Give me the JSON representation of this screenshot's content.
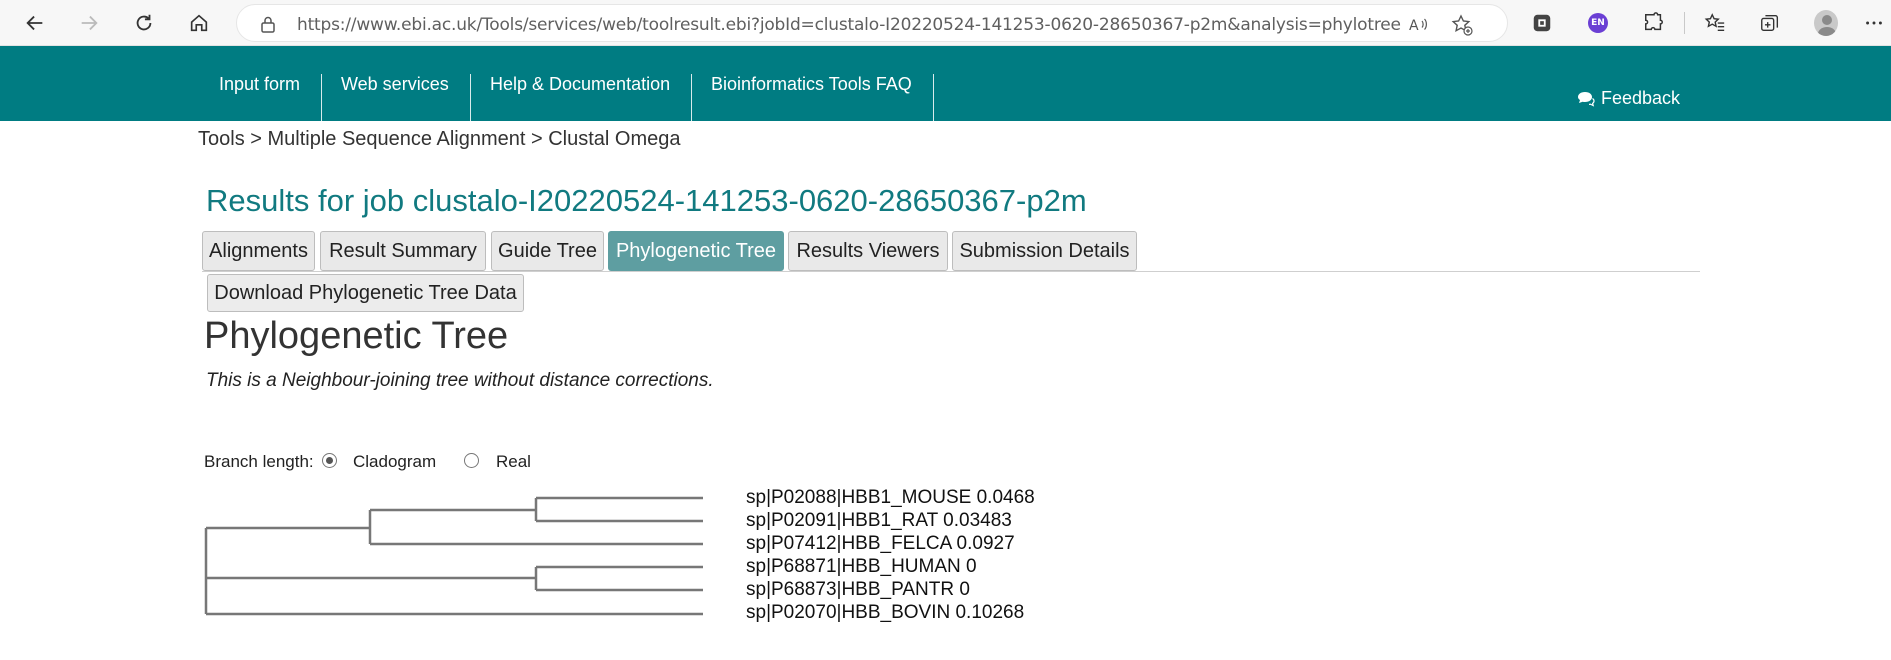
{
  "browser": {
    "url": "https://www.ebi.ac.uk/Tools/services/web/toolresult.ebi?jobId=clustalo-I20220524-141253-0620-28650367-p2m&analysis=phylotree",
    "extension_badge": "EN"
  },
  "site_nav": {
    "items": [
      "Input form",
      "Web services",
      "Help & Documentation",
      "Bioinformatics Tools FAQ"
    ],
    "feedback_label": "Feedback"
  },
  "breadcrumb": "Tools > Multiple Sequence Alignment > Clustal Omega",
  "job_title": "Results for job clustalo-I20220524-141253-0620-28650367-p2m",
  "tabs": [
    {
      "label": "Alignments",
      "active": false
    },
    {
      "label": "Result Summary",
      "active": false
    },
    {
      "label": "Guide Tree",
      "active": false
    },
    {
      "label": "Phylogenetic Tree",
      "active": true
    },
    {
      "label": "Results Viewers",
      "active": false
    },
    {
      "label": "Submission Details",
      "active": false
    }
  ],
  "download_label": "Download Phylogenetic Tree Data",
  "section_title": "Phylogenetic Tree",
  "tree_note": "This is a Neighbour-joining tree without distance corrections.",
  "branch_length": {
    "label": "Branch length:",
    "options": [
      {
        "label": "Cladogram",
        "selected": true
      },
      {
        "label": "Real",
        "selected": false
      }
    ]
  },
  "tree_leaves": [
    "sp|P02088|HBB1_MOUSE 0.0468",
    "sp|P02091|HBB1_RAT 0.03483",
    "sp|P07412|HBB_FELCA 0.0927",
    "sp|P68871|HBB_HUMAN 0",
    "sp|P68873|HBB_PANTR 0",
    "sp|P02070|HBB_BOVIN 0.10268"
  ],
  "colors": {
    "brand": "#007c82",
    "title": "#117a80",
    "active_tab": "#5e9ea1",
    "tree_lines": "#777777"
  }
}
